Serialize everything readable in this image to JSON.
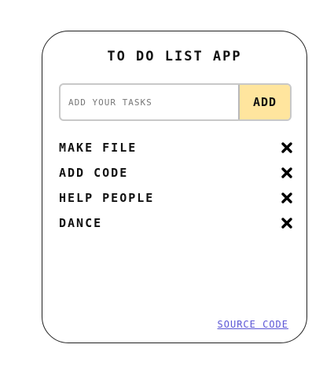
{
  "app": {
    "title": "TO DO LIST APP"
  },
  "input": {
    "value": "",
    "placeholder": "ADD YOUR TASKS",
    "add_label": "ADD"
  },
  "tasks": [
    {
      "label": "MAKE FILE",
      "icon": "close-icon"
    },
    {
      "label": "ADD CODE",
      "icon": "close-icon"
    },
    {
      "label": "HELP PEOPLE",
      "icon": "close-icon"
    },
    {
      "label": "DANCE",
      "icon": "close-icon"
    }
  ],
  "footer": {
    "source_label": "SOURCE CODE"
  },
  "colors": {
    "accent": "#ffe59e",
    "link": "#5b56d6",
    "border": "#222222"
  }
}
